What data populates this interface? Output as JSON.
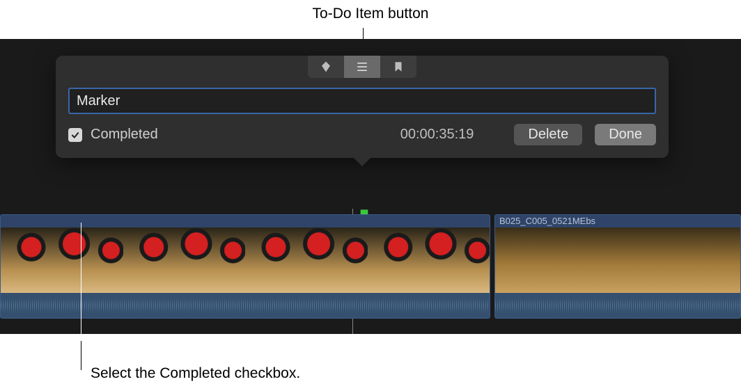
{
  "callouts": {
    "top": "To-Do Item button",
    "bottom": "Select the Completed checkbox."
  },
  "marker_types": {
    "standard": "standard-marker-icon",
    "todo": "todo-item-icon",
    "chapter": "chapter-marker-icon",
    "active": "todo"
  },
  "marker": {
    "name": "Marker",
    "completed_label": "Completed",
    "completed_checked": true,
    "timecode": "00:00:35:19"
  },
  "buttons": {
    "delete": "Delete",
    "done": "Done"
  },
  "clips": {
    "b_name": "B025_C005_0521MEbs"
  }
}
